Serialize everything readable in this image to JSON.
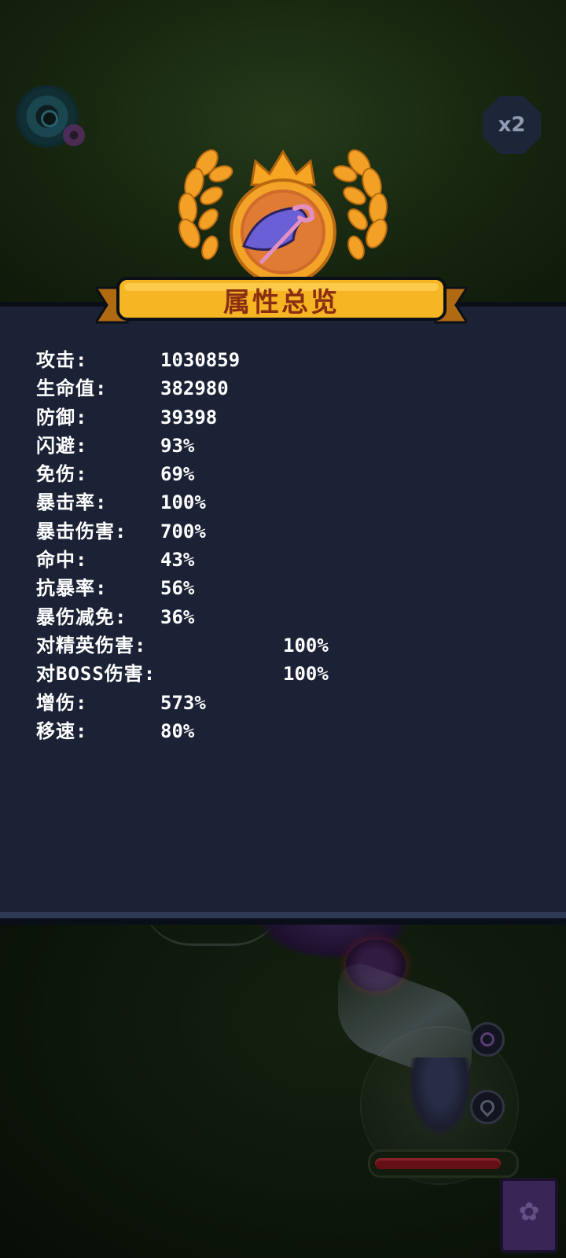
{
  "hud": {
    "speed_label": "x2",
    "settings_icon": "gear-icon"
  },
  "emblem": {
    "icon": "wizard-hat-staff-icon",
    "crown_icon": "crown-icon",
    "laurel_icon": "laurel-icon"
  },
  "panel": {
    "title": "属性总览",
    "stats": [
      {
        "label": "攻击:",
        "value": "1030859"
      },
      {
        "label": "生命值:",
        "value": "382980"
      },
      {
        "label": "防御:",
        "value": "39398"
      },
      {
        "label": "闪避:",
        "value": "93%"
      },
      {
        "label": "免伤:",
        "value": "69%"
      },
      {
        "label": "暴击率:",
        "value": "100%"
      },
      {
        "label": "暴击伤害:",
        "value": "700%"
      },
      {
        "label": "命中:",
        "value": "43%"
      },
      {
        "label": "抗暴率:",
        "value": "56%"
      },
      {
        "label": "暴伤减免:",
        "value": "36%"
      },
      {
        "label": "对精英伤害:",
        "value": "100%"
      },
      {
        "label": "对BOSS伤害:",
        "value": "100%"
      },
      {
        "label": "增伤:",
        "value": "573%"
      },
      {
        "label": "移速:",
        "value": "80%"
      }
    ]
  },
  "colors": {
    "panel_bg": "#1b2235",
    "banner_gold": "#f6b624",
    "title_text": "#8a2e12",
    "stat_text": "#ffffff"
  },
  "scene": {
    "hp_fraction": 0.92
  }
}
